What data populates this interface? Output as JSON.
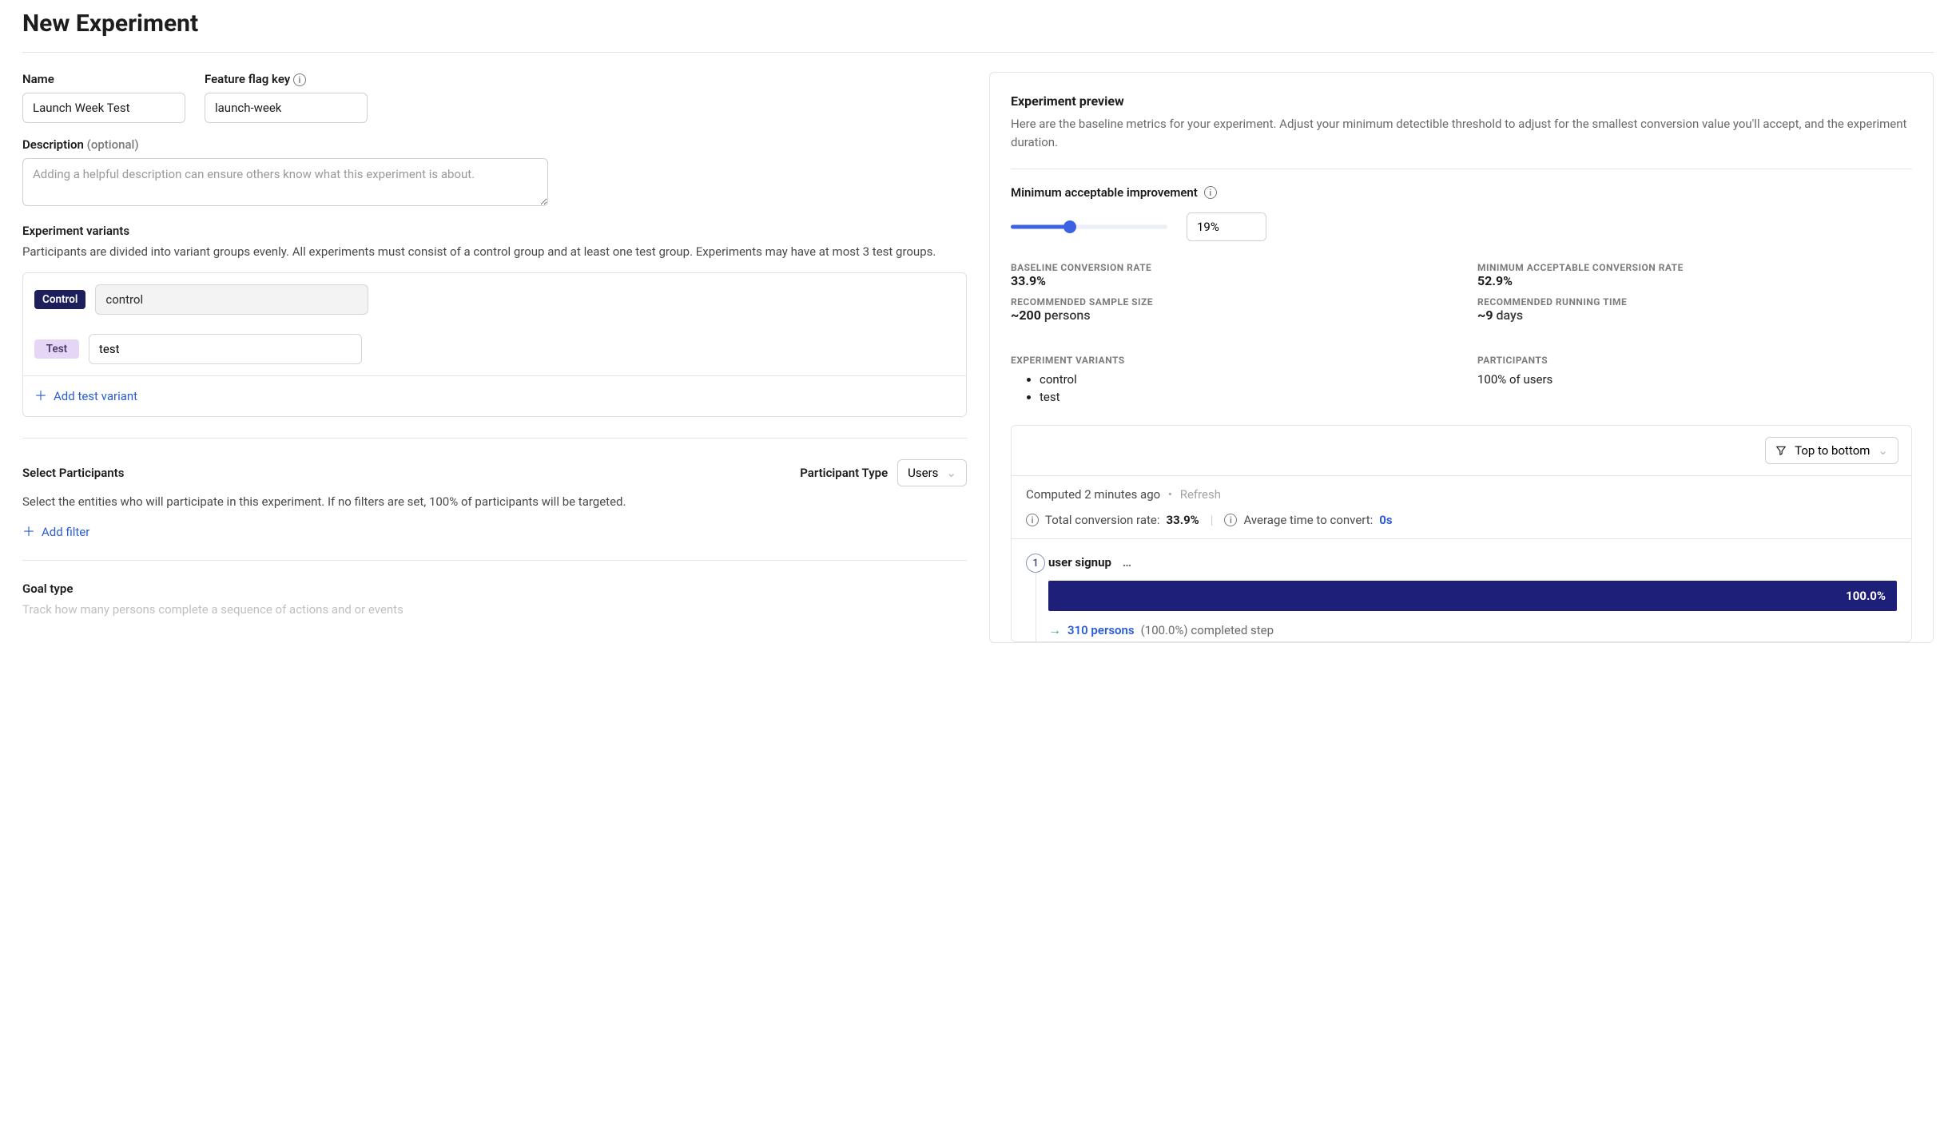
{
  "title": "New Experiment",
  "form": {
    "name_label": "Name",
    "name_value": "Launch Week Test",
    "flag_label": "Feature flag key",
    "flag_value": "launch-week",
    "desc_label": "Description",
    "desc_optional": "(optional)",
    "desc_placeholder": "Adding a helpful description can ensure others know what this experiment is about."
  },
  "variants": {
    "title": "Experiment variants",
    "help": "Participants are divided into variant groups evenly. All experiments must consist of a control group and at least one test group. Experiments may have at most 3 test groups.",
    "control_badge": "Control",
    "control_value": "control",
    "test_badge": "Test",
    "test_value": "test",
    "add_label": "Add test variant"
  },
  "participants": {
    "title": "Select Participants",
    "type_label": "Participant Type",
    "type_value": "Users",
    "help": "Select the entities who will participate in this experiment. If no filters are set, 100% of participants will be targeted.",
    "add_filter": "Add filter"
  },
  "goal": {
    "title": "Goal type",
    "help_fragment": "Track how many persons complete a sequence of actions and or events"
  },
  "preview": {
    "title": "Experiment preview",
    "help": "Here are the baseline metrics for your experiment. Adjust your minimum detectible threshold to adjust for the smallest conversion value you'll accept, and the experiment duration.",
    "mai_label": "Minimum acceptable improvement",
    "mai_value": "19%",
    "metrics": {
      "baseline_rate_label": "BASELINE CONVERSION RATE",
      "baseline_rate_value": "33.9%",
      "min_rate_label": "MINIMUM ACCEPTABLE CONVERSION RATE",
      "min_rate_value": "52.9%",
      "sample_label": "RECOMMENDED SAMPLE SIZE",
      "sample_value": "~200",
      "sample_unit": "persons",
      "runtime_label": "RECOMMENDED RUNNING TIME",
      "runtime_value": "~9",
      "runtime_unit": "days"
    },
    "variants_label": "EXPERIMENT VARIANTS",
    "variants_list": [
      "control",
      "test"
    ],
    "participants_label": "PARTICIPANTS",
    "participants_value": "100% of users"
  },
  "funnel": {
    "sort": "Top to bottom",
    "computed": "Computed 2 minutes ago",
    "refresh": "Refresh",
    "conv_label": "Total conversion rate:",
    "conv_value": "33.9%",
    "avg_label": "Average time to convert:",
    "avg_value": "0s",
    "step": {
      "num": "1",
      "name": "user signup",
      "bar_pct": "100.0%",
      "persons": "310 persons",
      "completed": "(100.0%) completed step"
    }
  }
}
